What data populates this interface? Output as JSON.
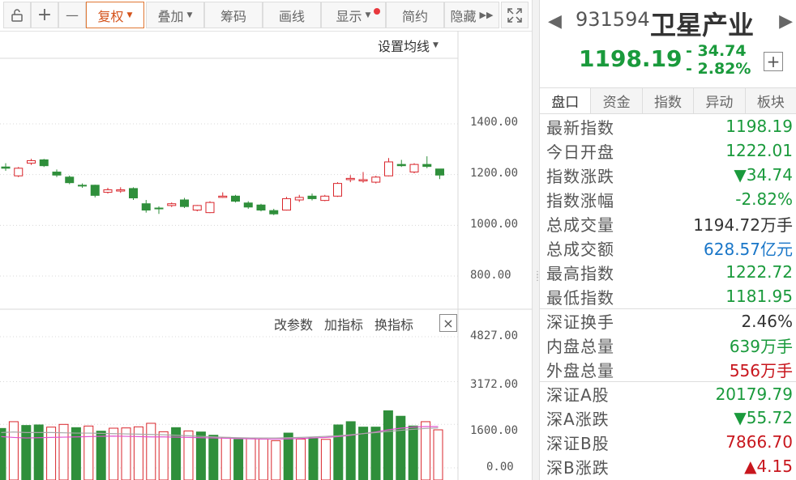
{
  "toolbar": {
    "buttons": [
      "",
      "+",
      "—",
      "复权",
      "叠加",
      "筹码",
      "画线",
      "显示",
      "简约",
      "隐藏"
    ],
    "expand_glyph": "⛶"
  },
  "chart": {
    "ma_setting_label": "设置均线",
    "indicator_buttons": [
      "改参数",
      "加指标",
      "换指标"
    ],
    "close_glyph": "×",
    "price_ticks": [
      "1400.00",
      "1200.00",
      "1000.00",
      "800.00"
    ],
    "volume_ticks": [
      "4827.00",
      "3172.00",
      "1600.00",
      "0.00"
    ]
  },
  "chart_data": [
    {
      "type": "candlestick",
      "y_ticks": [
        800,
        1000,
        1200,
        1400
      ],
      "ylim": [
        700,
        1480
      ],
      "candles": [
        {
          "o": 1230,
          "h": 1245,
          "l": 1215,
          "c": 1225
        },
        {
          "o": 1195,
          "h": 1230,
          "l": 1190,
          "c": 1225
        },
        {
          "o": 1245,
          "h": 1262,
          "l": 1238,
          "c": 1255
        },
        {
          "o": 1258,
          "h": 1262,
          "l": 1230,
          "c": 1235
        },
        {
          "o": 1210,
          "h": 1220,
          "l": 1190,
          "c": 1198
        },
        {
          "o": 1190,
          "h": 1196,
          "l": 1162,
          "c": 1168
        },
        {
          "o": 1158,
          "h": 1165,
          "l": 1148,
          "c": 1156
        },
        {
          "o": 1158,
          "h": 1160,
          "l": 1110,
          "c": 1118
        },
        {
          "o": 1130,
          "h": 1148,
          "l": 1125,
          "c": 1140
        },
        {
          "o": 1135,
          "h": 1150,
          "l": 1128,
          "c": 1140
        },
        {
          "o": 1145,
          "h": 1150,
          "l": 1100,
          "c": 1108
        },
        {
          "o": 1085,
          "h": 1100,
          "l": 1050,
          "c": 1060
        },
        {
          "o": 1068,
          "h": 1075,
          "l": 1045,
          "c": 1065
        },
        {
          "o": 1078,
          "h": 1090,
          "l": 1072,
          "c": 1085
        },
        {
          "o": 1100,
          "h": 1108,
          "l": 1068,
          "c": 1074
        },
        {
          "o": 1060,
          "h": 1080,
          "l": 1055,
          "c": 1078
        },
        {
          "o": 1050,
          "h": 1095,
          "l": 1048,
          "c": 1090
        },
        {
          "o": 1110,
          "h": 1130,
          "l": 1108,
          "c": 1115
        },
        {
          "o": 1115,
          "h": 1120,
          "l": 1090,
          "c": 1095
        },
        {
          "o": 1088,
          "h": 1095,
          "l": 1065,
          "c": 1072
        },
        {
          "o": 1080,
          "h": 1085,
          "l": 1055,
          "c": 1060
        },
        {
          "o": 1058,
          "h": 1065,
          "l": 1040,
          "c": 1045
        },
        {
          "o": 1060,
          "h": 1112,
          "l": 1058,
          "c": 1105
        },
        {
          "o": 1100,
          "h": 1120,
          "l": 1092,
          "c": 1110
        },
        {
          "o": 1115,
          "h": 1125,
          "l": 1098,
          "c": 1105
        },
        {
          "o": 1098,
          "h": 1120,
          "l": 1095,
          "c": 1115
        },
        {
          "o": 1115,
          "h": 1170,
          "l": 1112,
          "c": 1165
        },
        {
          "o": 1180,
          "h": 1198,
          "l": 1170,
          "c": 1185
        },
        {
          "o": 1175,
          "h": 1210,
          "l": 1168,
          "c": 1180
        },
        {
          "o": 1170,
          "h": 1195,
          "l": 1165,
          "c": 1190
        },
        {
          "o": 1195,
          "h": 1265,
          "l": 1193,
          "c": 1250
        },
        {
          "o": 1240,
          "h": 1258,
          "l": 1230,
          "c": 1235
        },
        {
          "o": 1210,
          "h": 1245,
          "l": 1205,
          "c": 1240
        },
        {
          "o": 1240,
          "h": 1272,
          "l": 1225,
          "c": 1232
        },
        {
          "o": 1222,
          "h": 1223,
          "l": 1182,
          "c": 1198
        }
      ]
    },
    {
      "type": "bar",
      "y_ticks": [
        0,
        1600,
        3172,
        4827
      ],
      "ylim": [
        0,
        5200
      ],
      "values": [
        1450,
        1700,
        1560,
        1580,
        1500,
        1600,
        1480,
        1540,
        1350,
        1460,
        1470,
        1510,
        1640,
        1330,
        1480,
        1360,
        1320,
        1200,
        1120,
        1050,
        1090,
        1060,
        1000,
        1280,
        1060,
        1100,
        1050,
        1580,
        1700,
        1500,
        1500,
        2100,
        1900,
        1540,
        1700,
        1400
      ],
      "up": [
        true,
        false,
        true,
        true,
        false,
        false,
        true,
        false,
        true,
        false,
        false,
        false,
        false,
        false,
        true,
        false,
        true,
        true,
        false,
        true,
        false,
        false,
        false,
        true,
        false,
        true,
        false,
        true,
        true,
        true,
        true,
        true,
        true,
        true,
        false,
        false
      ],
      "ma_lines": [
        {
          "color": "#e056d0",
          "values": [
            1150,
            1120,
            1100,
            1110,
            1120,
            1130,
            1140,
            1150,
            1160,
            1170,
            1160,
            1150,
            1140,
            1140,
            1130,
            1120,
            1110,
            1100,
            1090,
            1080,
            1070,
            1060,
            1060,
            1070,
            1080,
            1100,
            1120,
            1150,
            1200,
            1260,
            1320,
            1400,
            1460,
            1500,
            1520,
            1520
          ]
        },
        {
          "color": "#a7a7a7",
          "values": [
            1300,
            1320,
            1300,
            1300,
            1300,
            1290,
            1280,
            1280,
            1270,
            1260,
            1250,
            1240,
            1230,
            1220,
            1200,
            1180,
            1160,
            1140,
            1120,
            1110,
            1100,
            1100,
            1100,
            1110,
            1120,
            1140,
            1160,
            1180,
            1220,
            1260,
            1300,
            1340,
            1380,
            1420,
            1450,
            1470
          ]
        }
      ]
    }
  ],
  "panel": {
    "code": "931594",
    "name": "卫星产业",
    "price": "1198.19",
    "change": "- 34.74",
    "change_pct": "- 2.82%",
    "arrow_left": "◀",
    "arrow_right": "▶",
    "plus_glyph": "+",
    "tabs": [
      "盘口",
      "资金",
      "指数",
      "异动",
      "板块"
    ],
    "rows": [
      {
        "k": "最新指数",
        "v": "1198.19",
        "cls": "g"
      },
      {
        "k": "今日开盘",
        "v": "1222.01",
        "cls": "g"
      },
      {
        "k": "指数涨跌",
        "v": "▼34.74",
        "cls": "g"
      },
      {
        "k": "指数涨幅",
        "v": "-2.82%",
        "cls": "g"
      },
      {
        "k": "总成交量",
        "v": "1194.72万手",
        "cls": "k2"
      },
      {
        "k": "总成交额",
        "v": "628.57亿元",
        "cls": "b"
      },
      {
        "k": "最高指数",
        "v": "1222.72",
        "cls": "g"
      },
      {
        "k": "最低指数",
        "v": "1181.95",
        "cls": "g"
      },
      {
        "k": "深证换手",
        "v": "2.46%",
        "cls": "k2",
        "sep": true
      },
      {
        "k": "内盘总量",
        "v": "639万手",
        "cls": "g"
      },
      {
        "k": "外盘总量",
        "v": "556万手",
        "cls": "r"
      },
      {
        "k": "深证A股",
        "v": "20179.79",
        "cls": "g",
        "sep": true
      },
      {
        "k": "深A涨跌",
        "v": "▼55.72",
        "cls": "g"
      },
      {
        "k": "深证B股",
        "v": "7866.70",
        "cls": "r"
      },
      {
        "k": "深B涨跌",
        "v": "▲4.15",
        "cls": "r"
      }
    ]
  },
  "colors": {
    "up": "#d9262c",
    "down": "#2f8f3b",
    "grid": "#d8d8d8"
  }
}
